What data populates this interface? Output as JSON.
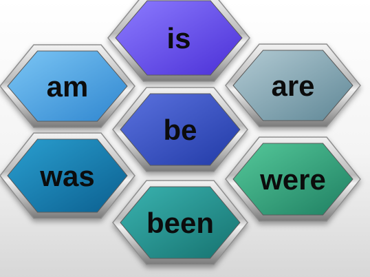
{
  "header": {
    "cut_off_text": ""
  },
  "hexagons": [
    {
      "id": "is",
      "label": "is",
      "color_light": "#8d7cff",
      "color_dark": "#4a2fd6"
    },
    {
      "id": "am",
      "label": "am",
      "color_light": "#7cc6f5",
      "color_dark": "#2f86cf"
    },
    {
      "id": "are",
      "label": "are",
      "color_light": "#b3cbd4",
      "color_dark": "#5f8796"
    },
    {
      "id": "be",
      "label": "be",
      "color_light": "#5b72df",
      "color_dark": "#213aa6"
    },
    {
      "id": "was",
      "label": "was",
      "color_light": "#2a9fd0",
      "color_dark": "#0b5f8f"
    },
    {
      "id": "were",
      "label": "were",
      "color_light": "#55c99a",
      "color_dark": "#1f7f62"
    },
    {
      "id": "been",
      "label": "been",
      "color_light": "#3ab3b0",
      "color_dark": "#16726f"
    }
  ],
  "frame": {
    "light": "#f2f2f2",
    "mid": "#b9b9b9",
    "dark": "#7a7a7a"
  }
}
